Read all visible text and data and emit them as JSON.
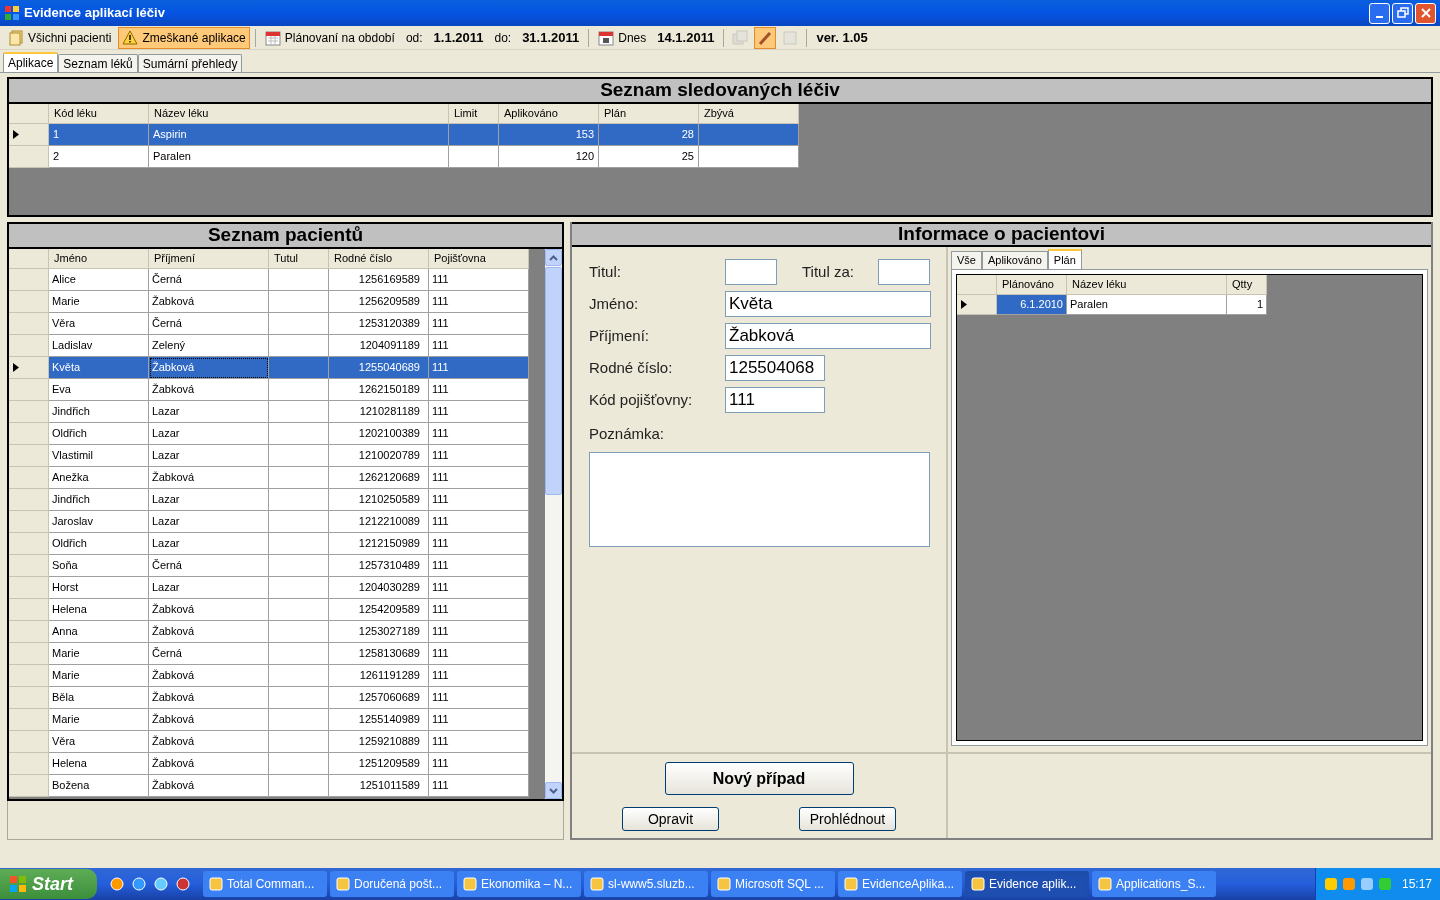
{
  "window": {
    "title": "Evidence aplikací léčiv"
  },
  "toolbar": [
    {
      "kind": "button",
      "label": "Všichni pacienti",
      "selected": false
    },
    {
      "kind": "button",
      "label": "Zmeškané aplikace",
      "selected": true
    },
    {
      "kind": "separator"
    },
    {
      "kind": "button",
      "label": "Plánovaní na období",
      "selected": false
    },
    {
      "kind": "label",
      "label": "od:"
    },
    {
      "kind": "value",
      "label": "1.1.2011"
    },
    {
      "kind": "label",
      "label": "do:"
    },
    {
      "kind": "value",
      "label": "31.1.2011"
    },
    {
      "kind": "separator"
    },
    {
      "kind": "button",
      "label": "Dnes",
      "selected": false
    },
    {
      "kind": "value",
      "label": "14.1.2011"
    },
    {
      "kind": "separator"
    },
    {
      "kind": "icon_button",
      "selected": false,
      "disabled": true
    },
    {
      "kind": "icon_button",
      "selected": true,
      "disabled": false
    },
    {
      "kind": "icon_button",
      "selected": false,
      "disabled": true
    },
    {
      "kind": "separator"
    },
    {
      "kind": "value",
      "label": "ver. 1.05"
    }
  ],
  "tabs": [
    {
      "label": "Aplikace",
      "selected": true
    },
    {
      "label": "Seznam léků",
      "selected": false
    },
    {
      "label": "Sumární přehledy",
      "selected": false
    }
  ],
  "drugs": {
    "title": "Seznam sledovaných léčiv",
    "columns": [
      "Kód léku",
      "Název léku",
      "Limit",
      "Aplikováno",
      "Plán",
      "Zbývá"
    ],
    "rows": [
      {
        "selected": true,
        "cells": [
          "1",
          "Aspirin",
          "",
          "153",
          "28",
          ""
        ]
      },
      {
        "selected": false,
        "cells": [
          "2",
          "Paralen",
          "",
          "120",
          "25",
          ""
        ]
      }
    ]
  },
  "patients": {
    "title": "Seznam pacientů",
    "columns": [
      "Jméno",
      "Příjmení",
      "Tutul",
      "Rodné číslo",
      "Pojišťovna"
    ],
    "rows": [
      {
        "selected": false,
        "cells": [
          "Alice",
          "Černá",
          "",
          "1256169589",
          "111"
        ]
      },
      {
        "selected": false,
        "cells": [
          "Marie",
          "Žabková",
          "",
          "1256209589",
          "111"
        ]
      },
      {
        "selected": false,
        "cells": [
          "Věra",
          "Černá",
          "",
          "1253120389",
          "111"
        ]
      },
      {
        "selected": false,
        "cells": [
          "Ladislav",
          "Zelený",
          "",
          "1204091189",
          "111"
        ]
      },
      {
        "selected": true,
        "cells": [
          "Květa",
          "Žabková",
          "",
          "1255040689",
          "111"
        ]
      },
      {
        "selected": false,
        "cells": [
          "Eva",
          "Žabková",
          "",
          "1262150189",
          "111"
        ]
      },
      {
        "selected": false,
        "cells": [
          "Jindřich",
          "Lazar",
          "",
          "1210281189",
          "111"
        ]
      },
      {
        "selected": false,
        "cells": [
          "Oldřich",
          "Lazar",
          "",
          "1202100389",
          "111"
        ]
      },
      {
        "selected": false,
        "cells": [
          "Vlastimil",
          "Lazar",
          "",
          "1210020789",
          "111"
        ]
      },
      {
        "selected": false,
        "cells": [
          "Anežka",
          "Žabková",
          "",
          "1262120689",
          "111"
        ]
      },
      {
        "selected": false,
        "cells": [
          "Jindřich",
          "Lazar",
          "",
          "1210250589",
          "111"
        ]
      },
      {
        "selected": false,
        "cells": [
          "Jaroslav",
          "Lazar",
          "",
          "1212210089",
          "111"
        ]
      },
      {
        "selected": false,
        "cells": [
          "Oldřich",
          "Lazar",
          "",
          "1212150989",
          "111"
        ]
      },
      {
        "selected": false,
        "cells": [
          "Soňa",
          "Černá",
          "",
          "1257310489",
          "111"
        ]
      },
      {
        "selected": false,
        "cells": [
          "Horst",
          "Lazar",
          "",
          "1204030289",
          "111"
        ]
      },
      {
        "selected": false,
        "cells": [
          "Helena",
          "Žabková",
          "",
          "1254209589",
          "111"
        ]
      },
      {
        "selected": false,
        "cells": [
          "Anna",
          "Žabková",
          "",
          "1253027189",
          "111"
        ]
      },
      {
        "selected": false,
        "cells": [
          "Marie",
          "Černá",
          "",
          "1258130689",
          "111"
        ]
      },
      {
        "selected": false,
        "cells": [
          "Marie",
          "Žabková",
          "",
          "1261191289",
          "111"
        ]
      },
      {
        "selected": false,
        "cells": [
          "Běla",
          "Žabková",
          "",
          "1257060689",
          "111"
        ]
      },
      {
        "selected": false,
        "cells": [
          "Marie",
          "Žabková",
          "",
          "1255140989",
          "111"
        ]
      },
      {
        "selected": false,
        "cells": [
          "Věra",
          "Žabková",
          "",
          "1259210889",
          "111"
        ]
      },
      {
        "selected": false,
        "cells": [
          "Helena",
          "Žabková",
          "",
          "1251209589",
          "111"
        ]
      },
      {
        "selected": false,
        "cells": [
          "Božena",
          "Žabková",
          "",
          "1251011589",
          "111"
        ]
      }
    ]
  },
  "patient_info": {
    "title": "Informace o pacientovi",
    "fields": [
      {
        "label": "Titul:"
      },
      {
        "label": "Titul za:"
      },
      {
        "label": "Jméno:",
        "value": "Květa"
      },
      {
        "label": "Příjmení:",
        "value": "Žabková"
      },
      {
        "label": "Rodné číslo:",
        "value": "125504068"
      },
      {
        "label": "Kód pojišťovny:",
        "value": "111"
      }
    ],
    "note": {
      "label": "Poznámka:"
    },
    "buttons": [
      "Nový případ",
      "Opravit",
      "Prohlédnout"
    ],
    "tabs": [
      {
        "label": "Vše",
        "selected": false
      },
      {
        "label": "Aplikováno",
        "selected": false
      },
      {
        "label": "Plán",
        "selected": true
      }
    ],
    "plan": {
      "columns": [
        "Plánováno",
        "Název léku",
        "Qtty"
      ],
      "rows": [
        {
          "current": true,
          "cells": [
            {
              "text": "6.1.2010",
              "selected": true
            },
            {
              "text": "Paralen",
              "selected": false
            },
            {
              "text": "1",
              "selected": false
            }
          ]
        }
      ]
    }
  },
  "taskbar": {
    "start": "Start",
    "tasks": [
      {
        "label": "Total Comman...",
        "selected": false
      },
      {
        "label": "Doručená pošt...",
        "selected": false
      },
      {
        "label": "Ekonomika – N...",
        "selected": false
      },
      {
        "label": "sl-www5.sluzb...",
        "selected": false
      },
      {
        "label": "Microsoft SQL ...",
        "selected": false
      },
      {
        "label": "EvidenceAplika...",
        "selected": false
      },
      {
        "label": "Evidence aplik...",
        "selected": true
      },
      {
        "label": "Applications_S...",
        "selected": false
      }
    ],
    "clock": "15:17"
  }
}
